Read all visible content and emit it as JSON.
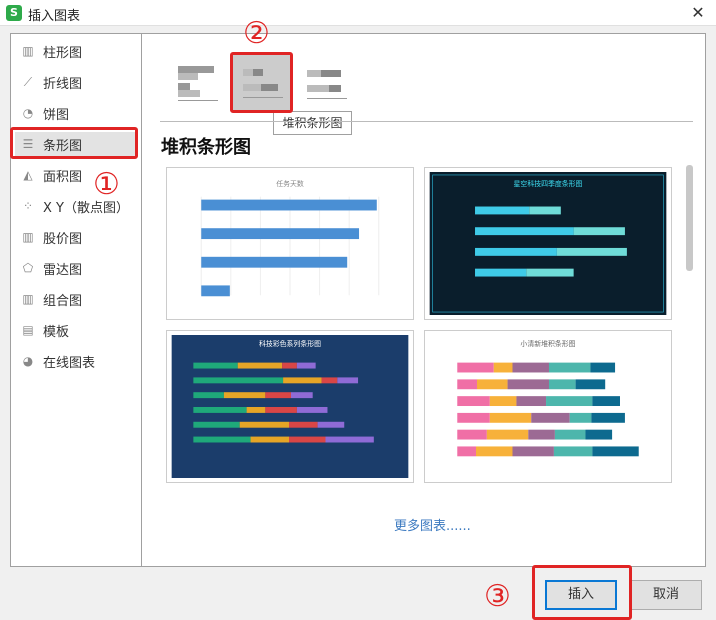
{
  "window": {
    "title": "插入图表",
    "icon": "wps-spreadsheet-icon",
    "close_icon": "close-icon"
  },
  "sidebar": {
    "items": [
      {
        "label": "柱形图",
        "icon": "column-chart-icon",
        "glyph": "▥"
      },
      {
        "label": "折线图",
        "icon": "line-chart-icon",
        "glyph": "⟋"
      },
      {
        "label": "饼图",
        "icon": "pie-chart-icon",
        "glyph": "◔"
      },
      {
        "label": "条形图",
        "icon": "bar-chart-icon",
        "glyph": "☰",
        "selected": true
      },
      {
        "label": "面积图",
        "icon": "area-chart-icon",
        "glyph": "◭"
      },
      {
        "label": "X Y（散点图）",
        "icon": "scatter-chart-icon",
        "glyph": "⁘"
      },
      {
        "label": "股价图",
        "icon": "stock-chart-icon",
        "glyph": "▥"
      },
      {
        "label": "雷达图",
        "icon": "radar-chart-icon",
        "glyph": "⬠"
      },
      {
        "label": "组合图",
        "icon": "combo-chart-icon",
        "glyph": "▥"
      },
      {
        "label": "模板",
        "icon": "template-icon",
        "glyph": "▤"
      },
      {
        "label": "在线图表",
        "icon": "online-chart-icon",
        "glyph": "◕"
      }
    ]
  },
  "subtypes": [
    {
      "name": "clustered-bar"
    },
    {
      "name": "stacked-bar",
      "selected": true
    },
    {
      "name": "percent-stacked-bar"
    }
  ],
  "tooltip": "堆积条形图",
  "heading": "堆积条形图",
  "templates": [
    {
      "title": "任务天数",
      "theme": "light"
    },
    {
      "title": "星空科技四季度条形图",
      "theme": "space"
    },
    {
      "title": "科技彩色系列条形图",
      "theme": "navy"
    },
    {
      "title": "小清新堆积条形图",
      "theme": "fresh"
    }
  ],
  "more_link": "更多图表......",
  "buttons": {
    "insert": "插入",
    "cancel": "取消"
  },
  "annotations": {
    "step1": "①",
    "step2": "②",
    "step3": "③",
    "color": "#e02424"
  },
  "colors": {
    "accent": "#0a78d4",
    "link": "#3c7ac0"
  }
}
